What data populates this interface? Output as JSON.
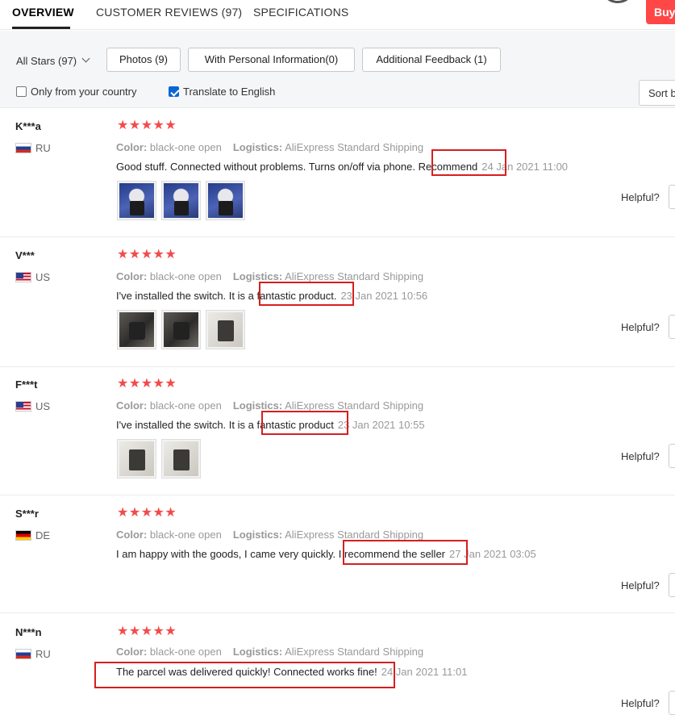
{
  "tabs": [
    {
      "label": "OVERVIEW",
      "active": true
    },
    {
      "label": "CUSTOMER REVIEWS (97)",
      "active": false
    },
    {
      "label": "SPECIFICATIONS",
      "active": false
    }
  ],
  "buy_button": "Buy",
  "filters": {
    "all_stars": "All Stars (97)",
    "buttons": [
      "Photos (9)",
      "With Personal Information(0)",
      "Additional Feedback (1)"
    ],
    "only_country": {
      "label": "Only from your country",
      "checked": false
    },
    "translate": {
      "label": "Translate to English",
      "checked": true
    },
    "sort": "Sort b"
  },
  "labels": {
    "color": "Color:",
    "logistics": "Logistics:",
    "helpful": "Helpful?"
  },
  "reviews": [
    {
      "user": "K***a",
      "country": "RU",
      "stars": "★★★★★",
      "color_value": "black-one open",
      "logistics_value": "AliExpress Standard Shipping",
      "text": "Good stuff. Connected without problems. Turns on/off via phone. ",
      "highlight": "Recommend",
      "date": "24 Jan 2021 11:00"
    },
    {
      "user": "V***",
      "country": "US",
      "stars": "★★★★★",
      "color_value": "black-one open",
      "logistics_value": "AliExpress Standard Shipping",
      "text": "I've installed the switch. It is a ",
      "highlight": "fantastic product.",
      "date": "23 Jan 2021 10:56"
    },
    {
      "user": "F***t",
      "country": "US",
      "stars": "★★★★★",
      "color_value": "black-one open",
      "logistics_value": "AliExpress Standard Shipping",
      "text": "I've installed the switch. It is a ",
      "highlight": "fantastic product",
      "date": "23 Jan 2021 10:55"
    },
    {
      "user": "S***r",
      "country": "DE",
      "stars": "★★★★★",
      "color_value": "black-one open",
      "logistics_value": "AliExpress Standard Shipping",
      "text": "I am happy with the goods, I came very quickly. ",
      "highlight": "I recommend the seller",
      "date": "27 Jan 2021 03:05"
    },
    {
      "user": "N***n",
      "country": "RU",
      "stars": "★★★★★",
      "color_value": "black-one open",
      "logistics_value": "AliExpress Standard Shipping",
      "text": "",
      "highlight": "The parcel was delivered quickly! Connected works fine!",
      "date": "24 Jan 2021 11:01"
    }
  ]
}
